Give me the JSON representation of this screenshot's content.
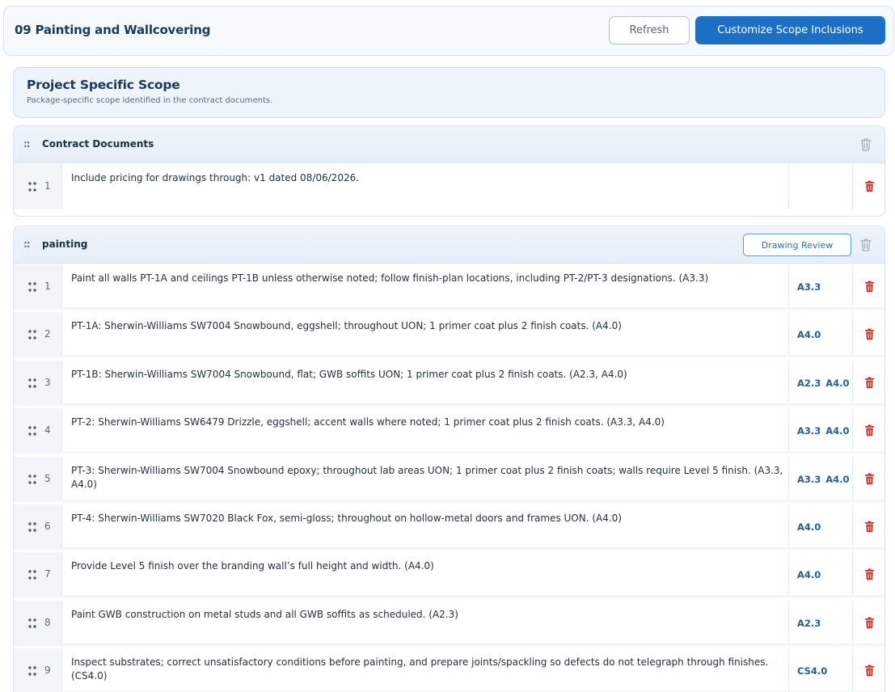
{
  "header": {
    "title": "09 Painting and Wallcovering",
    "refresh_label": "Refresh",
    "customize_label": "Customize Scope Inclusions"
  },
  "scope": {
    "title": "Project Specific Scope",
    "subtitle": "Package-specific scope identified in the contract documents."
  },
  "sections": {
    "contract": {
      "title": "Contract Documents",
      "rows": [
        {
          "num": "1",
          "text": "Include pricing for drawings through: v1 dated 08/06/2026.",
          "refs": []
        }
      ]
    },
    "painting": {
      "title": "painting",
      "review_label": "Drawing Review",
      "rows": [
        {
          "num": "1",
          "text": "Paint all walls PT-1A and ceilings PT-1B unless otherwise noted; follow finish-plan locations, including PT-2/PT-3 designations. (A3.3)",
          "refs": [
            "A3.3"
          ]
        },
        {
          "num": "2",
          "text": "PT-1A: Sherwin-Williams SW7004 Snowbound, eggshell; throughout UON; 1 primer coat plus 2 finish coats. (A4.0)",
          "refs": [
            "A4.0"
          ]
        },
        {
          "num": "3",
          "text": "PT-1B: Sherwin-Williams SW7004 Snowbound, flat; GWB soffits UON; 1 primer coat plus 2 finish coats. (A2.3, A4.0)",
          "refs": [
            "A2.3",
            "A4.0"
          ]
        },
        {
          "num": "4",
          "text": "PT-2: Sherwin-Williams SW6479 Drizzle, eggshell; accent walls where noted; 1 primer coat plus 2 finish coats. (A3.3, A4.0)",
          "refs": [
            "A3.3",
            "A4.0"
          ]
        },
        {
          "num": "5",
          "text": "PT-3: Sherwin-Williams SW7004 Snowbound epoxy; throughout lab areas UON; 1 primer coat plus 2 finish coats; walls require Level 5 finish. (A3.3, A4.0)",
          "refs": [
            "A3.3",
            "A4.0"
          ]
        },
        {
          "num": "6",
          "text": "PT-4: Sherwin-Williams SW7020 Black Fox, semi-gloss; throughout on hollow-metal doors and frames UON. (A4.0)",
          "refs": [
            "A4.0"
          ]
        },
        {
          "num": "7",
          "text": "Provide Level 5 finish over the branding wall’s full height and width. (A4.0)",
          "refs": [
            "A4.0"
          ]
        },
        {
          "num": "8",
          "text": "Paint GWB construction on metal studs and all GWB soffits as scheduled. (A2.3)",
          "refs": [
            "A2.3"
          ]
        },
        {
          "num": "9",
          "text": "Inspect substrates; correct unsatisfactory conditions before painting, and prepare joints/spackling so defects do not telegraph through finishes. (CS4.0)",
          "refs": [
            "CS4.0"
          ]
        }
      ]
    }
  },
  "colors": {
    "accent": "#1c6fc4",
    "danger": "#c0392b",
    "ref_text": "#205f9e"
  },
  "icons": {
    "section_drag": "drag-handle-icon",
    "row_drag": "grip-dots-icon",
    "delete": "trash-icon"
  }
}
